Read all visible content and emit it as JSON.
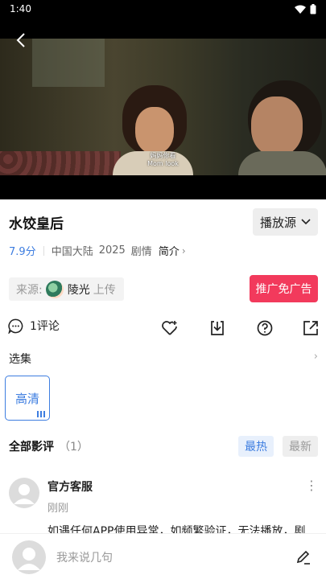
{
  "status_bar": {
    "time": "1:40"
  },
  "video": {
    "subtitle_cn": "妈妈你看",
    "subtitle_en": "Mom look"
  },
  "title": "水饺皇后",
  "source_selector": {
    "label": "播放源"
  },
  "meta": {
    "rating": "7.9分",
    "region": "中国大陆",
    "year": "2025",
    "genre": "剧情",
    "intro_label": "简介"
  },
  "uploader": {
    "prefix": "来源:",
    "name": "陵光",
    "suffix": "上传"
  },
  "promo_button": "推广免广告",
  "actions": {
    "comment_label": "1评论",
    "icons": [
      "comment-icon",
      "favorite-add-icon",
      "download-icon",
      "help-icon",
      "share-icon"
    ]
  },
  "episodes": {
    "label": "选集",
    "items": [
      {
        "label": "高清",
        "selected": true
      }
    ]
  },
  "reviews": {
    "title": "全部影评",
    "count": "（1）",
    "sort_hot": "最热",
    "sort_new": "最新",
    "items": [
      {
        "author": "官方客服",
        "time": "刚刚",
        "text": "如遇任何APP使用异常，如频繁验证，无法播放，剧"
      }
    ]
  },
  "comment_bar": {
    "placeholder": "我来说几句"
  },
  "colors": {
    "accent": "#3d7de0",
    "promo": "#f23a5c"
  }
}
